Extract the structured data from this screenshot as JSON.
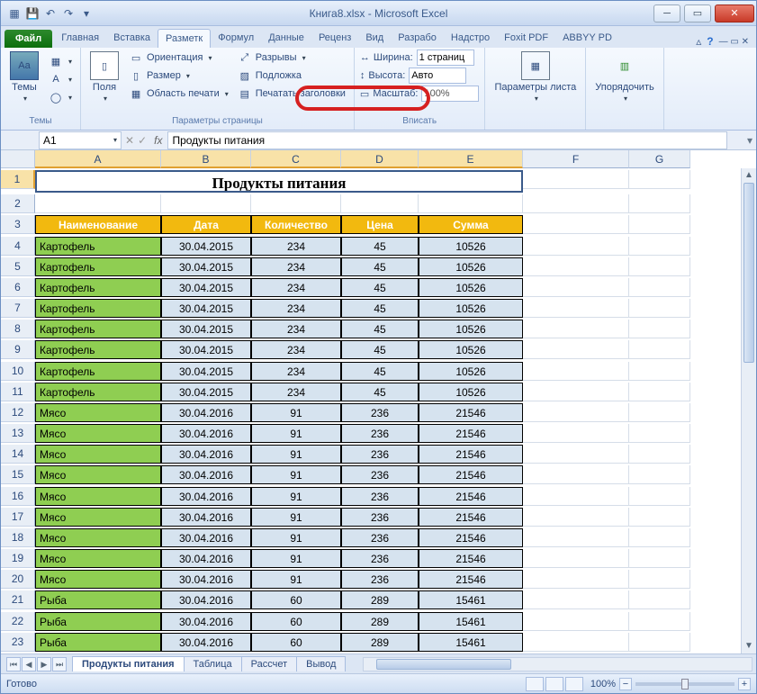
{
  "window": {
    "title_file": "Книга8.xlsx",
    "title_app": "Microsoft Excel"
  },
  "qat": {
    "save": "💾",
    "undo": "↶",
    "redo": "↷"
  },
  "tabs": {
    "file": "Файл",
    "list": [
      "Главная",
      "Вставка",
      "Разметк",
      "Формул",
      "Данные",
      "Реценз",
      "Вид",
      "Разрабо",
      "Надстро",
      "Foxit PDF",
      "ABBYY PD"
    ],
    "active_index": 2
  },
  "ribbon": {
    "themes": {
      "btn": "Темы",
      "label": "Темы"
    },
    "page_setup": {
      "margins": "Поля",
      "orientation": "Ориентация",
      "size": "Размер",
      "print_area": "Область печати",
      "breaks": "Разрывы",
      "background": "Подложка",
      "print_titles": "Печатать заголовки",
      "label": "Параметры страницы"
    },
    "scale": {
      "width_lbl": "Ширина:",
      "width_val": "1 страниц",
      "height_lbl": "Высота:",
      "height_val": "Авто",
      "scale_lbl": "Масштаб:",
      "scale_val": "100%",
      "label": "Вписать"
    },
    "sheet_opts": {
      "btn": "Параметры листа"
    },
    "arrange": {
      "btn": "Упорядочить"
    }
  },
  "namebox": "A1",
  "formula": "Продукты питания",
  "columns": [
    "A",
    "B",
    "C",
    "D",
    "E",
    "F",
    "G"
  ],
  "title_row": "Продукты питания",
  "headers": [
    "Наименование",
    "Дата",
    "Количество",
    "Цена",
    "Сумма"
  ],
  "rows": [
    {
      "n": "Картофель",
      "d": "30.04.2015",
      "q": "234",
      "p": "45",
      "s": "10526"
    },
    {
      "n": "Картофель",
      "d": "30.04.2015",
      "q": "234",
      "p": "45",
      "s": "10526"
    },
    {
      "n": "Картофель",
      "d": "30.04.2015",
      "q": "234",
      "p": "45",
      "s": "10526"
    },
    {
      "n": "Картофель",
      "d": "30.04.2015",
      "q": "234",
      "p": "45",
      "s": "10526"
    },
    {
      "n": "Картофель",
      "d": "30.04.2015",
      "q": "234",
      "p": "45",
      "s": "10526"
    },
    {
      "n": "Картофель",
      "d": "30.04.2015",
      "q": "234",
      "p": "45",
      "s": "10526"
    },
    {
      "n": "Картофель",
      "d": "30.04.2015",
      "q": "234",
      "p": "45",
      "s": "10526"
    },
    {
      "n": "Картофель",
      "d": "30.04.2015",
      "q": "234",
      "p": "45",
      "s": "10526"
    },
    {
      "n": "Мясо",
      "d": "30.04.2016",
      "q": "91",
      "p": "236",
      "s": "21546"
    },
    {
      "n": "Мясо",
      "d": "30.04.2016",
      "q": "91",
      "p": "236",
      "s": "21546"
    },
    {
      "n": "Мясо",
      "d": "30.04.2016",
      "q": "91",
      "p": "236",
      "s": "21546"
    },
    {
      "n": "Мясо",
      "d": "30.04.2016",
      "q": "91",
      "p": "236",
      "s": "21546"
    },
    {
      "n": "Мясо",
      "d": "30.04.2016",
      "q": "91",
      "p": "236",
      "s": "21546"
    },
    {
      "n": "Мясо",
      "d": "30.04.2016",
      "q": "91",
      "p": "236",
      "s": "21546"
    },
    {
      "n": "Мясо",
      "d": "30.04.2016",
      "q": "91",
      "p": "236",
      "s": "21546"
    },
    {
      "n": "Мясо",
      "d": "30.04.2016",
      "q": "91",
      "p": "236",
      "s": "21546"
    },
    {
      "n": "Мясо",
      "d": "30.04.2016",
      "q": "91",
      "p": "236",
      "s": "21546"
    },
    {
      "n": "Рыба",
      "d": "30.04.2016",
      "q": "60",
      "p": "289",
      "s": "15461"
    },
    {
      "n": "Рыба",
      "d": "30.04.2016",
      "q": "60",
      "p": "289",
      "s": "15461"
    },
    {
      "n": "Рыба",
      "d": "30.04.2016",
      "q": "60",
      "p": "289",
      "s": "15461"
    }
  ],
  "sheets": {
    "list": [
      "Продукты питания",
      "Таблица",
      "Рассчет",
      "Вывод"
    ],
    "active_index": 0
  },
  "status": {
    "ready": "Готово",
    "zoom": "100%"
  }
}
